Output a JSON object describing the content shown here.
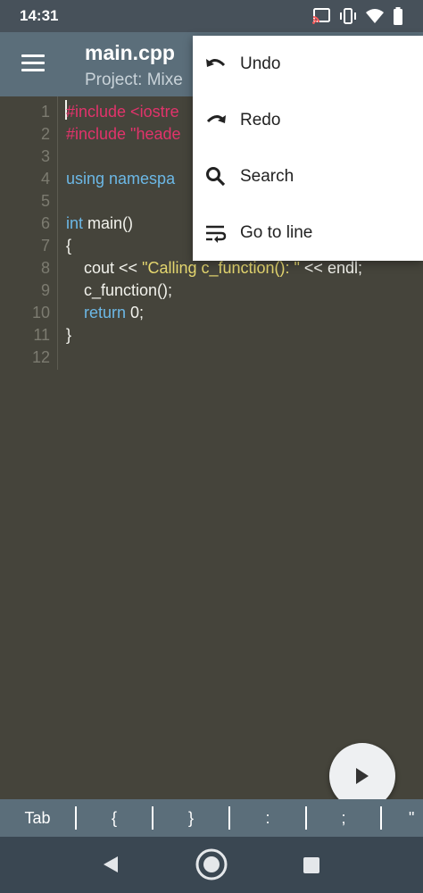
{
  "status_bar": {
    "time": "14:31"
  },
  "app_bar": {
    "title": "main.cpp",
    "subtitle": "Project: Mixe"
  },
  "editor": {
    "lines": [
      {
        "number": "1",
        "segments": [
          {
            "text": "#include <iostre",
            "style": "pp"
          }
        ]
      },
      {
        "number": "2",
        "segments": [
          {
            "text": "#include \"heade",
            "style": "pp"
          }
        ]
      },
      {
        "number": "3",
        "segments": []
      },
      {
        "number": "4",
        "segments": [
          {
            "text": "using namespa",
            "style": "kw"
          }
        ]
      },
      {
        "number": "5",
        "segments": []
      },
      {
        "number": "6",
        "segments": [
          {
            "text": "int",
            "style": "kw"
          },
          {
            "text": " main()",
            "style": "tx"
          }
        ]
      },
      {
        "number": "7",
        "segments": [
          {
            "text": "{",
            "style": "tx"
          }
        ]
      },
      {
        "number": "8",
        "segments": [
          {
            "text": "    cout << ",
            "style": "tx"
          },
          {
            "text": "\"Calling c_function(): \"",
            "style": "str"
          },
          {
            "text": " << endl;",
            "style": "tx"
          }
        ]
      },
      {
        "number": "9",
        "segments": [
          {
            "text": "    c_function();",
            "style": "tx"
          }
        ]
      },
      {
        "number": "10",
        "segments": [
          {
            "text": "    ",
            "style": "tx"
          },
          {
            "text": "return",
            "style": "kw"
          },
          {
            "text": " 0;",
            "style": "tx"
          }
        ]
      },
      {
        "number": "11",
        "segments": [
          {
            "text": "}",
            "style": "tx"
          }
        ]
      },
      {
        "number": "12",
        "segments": []
      }
    ]
  },
  "popup_menu": {
    "items": [
      {
        "label": "Undo",
        "icon": "undo-icon"
      },
      {
        "label": "Redo",
        "icon": "redo-icon"
      },
      {
        "label": "Search",
        "icon": "search-icon"
      },
      {
        "label": "Go to line",
        "icon": "go-to-line-icon"
      }
    ]
  },
  "fab": {
    "icon": "play-icon"
  },
  "symbol_bar": {
    "keys": [
      "Tab",
      "{",
      "}",
      ":",
      ";",
      "\""
    ]
  },
  "nav_bar": {
    "buttons": [
      "back-icon",
      "home-icon",
      "recents-icon"
    ]
  },
  "colors": {
    "editor_background": "#45443b",
    "app_bar": "#5b6e7a",
    "preprocessor": "#e2336b",
    "keyword": "#6cb8e6",
    "string": "#e4d66f",
    "text": "#f2f2ec",
    "line_number": "#7c7b70"
  }
}
